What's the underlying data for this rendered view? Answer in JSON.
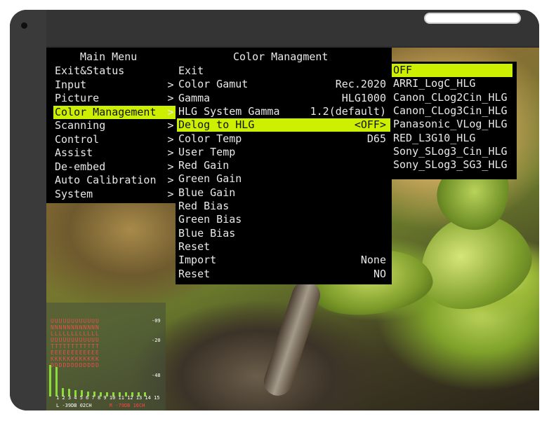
{
  "main_menu": {
    "title": "Main Menu",
    "items": [
      "Exit&Status",
      "Input",
      "Picture",
      "Color Management",
      "Scanning",
      "Control",
      "Assist",
      "De-embed",
      "Auto Calibration",
      "System"
    ],
    "selected_index": 3
  },
  "color_menu": {
    "title": "Color Managment",
    "items": [
      {
        "label": "Exit",
        "value": ""
      },
      {
        "label": "Color Gamut",
        "value": "Rec.2020"
      },
      {
        "label": "Gamma",
        "value": "HLG1000"
      },
      {
        "label": "HLG System Gamma",
        "value": "1.2(default)"
      },
      {
        "label": "Delog to HLG",
        "value": "<OFF>"
      },
      {
        "label": "Color Temp",
        "value": "D65"
      },
      {
        "label": "User Temp",
        "value": ""
      },
      {
        "label": "Red Gain",
        "value": ""
      },
      {
        "label": "Green Gain",
        "value": ""
      },
      {
        "label": "Blue Gain",
        "value": ""
      },
      {
        "label": "Red Bias",
        "value": ""
      },
      {
        "label": "Green Bias",
        "value": ""
      },
      {
        "label": "Blue Bias",
        "value": ""
      },
      {
        "label": "Reset",
        "value": ""
      },
      {
        "label": "Import",
        "value": "None"
      },
      {
        "label": "Reset",
        "value": "NO"
      }
    ],
    "selected_index": 4
  },
  "option_menu": {
    "items": [
      "OFF",
      "ARRI_LogC_HLG",
      "Canon_CLog2Cin_HLG",
      "Canon_CLog3Cin_HLG",
      "Panasonic_VLog_HLG",
      "RED_L3G10_HLG",
      "Sony_SLog3_Cin_HLG",
      "Sony_SLog3_SG3_HLG"
    ],
    "selected_index": 0
  },
  "audio": {
    "scale": [
      "-09",
      "-20",
      "-48"
    ],
    "channels": "1 2 3 4 5 6 7 8 9 10 11 12 13 14 15",
    "levels": [
      0.75,
      0.7,
      0.2,
      0.18,
      0.15,
      0.15,
      0.12,
      0.12,
      0.1,
      0.1,
      0.1,
      0.1,
      0.1,
      0.1,
      0.1,
      0.1
    ],
    "left_readout": "L -39DB 02CH",
    "right_readout": "R -79DB 16CH"
  },
  "colors": {
    "highlight": "#ccf000",
    "menu_bg": "#000000",
    "text": "#e8e8e8",
    "meter_bar": "#8bdc3a"
  }
}
